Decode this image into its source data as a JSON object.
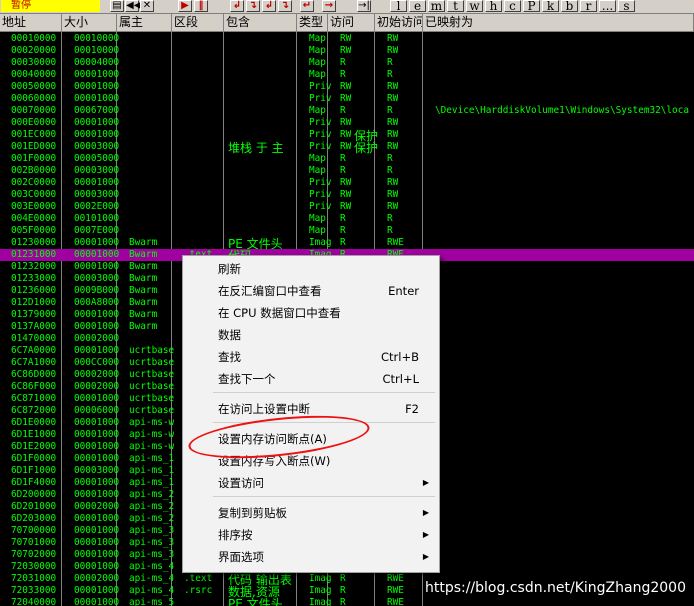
{
  "toolbar": {
    "status": "暂停",
    "icons": [
      "open-icon",
      "rewind-icon",
      "close-icon",
      "run-icon",
      "pause-icon",
      "step-into-icon",
      "step-over-icon",
      "trace-into-icon",
      "trace-over-icon",
      "execute-till-return-icon",
      "goto-icon"
    ],
    "letters": [
      "l",
      "e",
      "m",
      "t",
      "w",
      "h",
      "c",
      "P",
      "k",
      "b",
      "r",
      "...",
      "s"
    ]
  },
  "columns": [
    "地址",
    "大小",
    "属主",
    "区段",
    "包含",
    "类型",
    "访问",
    "初始访问",
    "已映射为"
  ],
  "rows": [
    {
      "addr": "00010000",
      "size": "00010000",
      "owner": "",
      "section": "",
      "contains": "",
      "type": "Map",
      "access": "RW",
      "init": "RW",
      "mapped": ""
    },
    {
      "addr": "00020000",
      "size": "00010000",
      "owner": "",
      "section": "",
      "contains": "",
      "type": "Map",
      "access": "RW",
      "init": "RW",
      "mapped": ""
    },
    {
      "addr": "00030000",
      "size": "00004000",
      "owner": "",
      "section": "",
      "contains": "",
      "type": "Map",
      "access": "R",
      "init": "R",
      "mapped": ""
    },
    {
      "addr": "00040000",
      "size": "00001000",
      "owner": "",
      "section": "",
      "contains": "",
      "type": "Map",
      "access": "R",
      "init": "R",
      "mapped": ""
    },
    {
      "addr": "00050000",
      "size": "00001000",
      "owner": "",
      "section": "",
      "contains": "",
      "type": "Priv",
      "access": "RW",
      "init": "RW",
      "mapped": ""
    },
    {
      "addr": "00060000",
      "size": "00001000",
      "owner": "",
      "section": "",
      "contains": "",
      "type": "Priv",
      "access": "RW",
      "init": "RW",
      "mapped": ""
    },
    {
      "addr": "00070000",
      "size": "00067000",
      "owner": "",
      "section": "",
      "contains": "",
      "type": "Map",
      "access": "R",
      "init": "R",
      "mapped": "\\Device\\HarddiskVolume1\\Windows\\System32\\loca"
    },
    {
      "addr": "000E0000",
      "size": "00001000",
      "owner": "",
      "section": "",
      "contains": "",
      "type": "Priv",
      "access": "RW",
      "init": "RW",
      "mapped": ""
    },
    {
      "addr": "001EC000",
      "size": "00001000",
      "owner": "",
      "section": "",
      "contains": "",
      "type": "Priv",
      "access": "RW",
      "init": "RW",
      "mapped": ""
    },
    {
      "addr": "001ED000",
      "size": "00003000",
      "owner": "",
      "section": "",
      "contains": "",
      "type": "Priv",
      "access": "RW",
      "init": "RW",
      "mapped": ""
    },
    {
      "addr": "001F0000",
      "size": "00005000",
      "owner": "",
      "section": "",
      "contains": "",
      "type": "Map",
      "access": "R",
      "init": "R",
      "mapped": ""
    },
    {
      "addr": "002B0000",
      "size": "00003000",
      "owner": "",
      "section": "",
      "contains": "",
      "type": "Map",
      "access": "R",
      "init": "R",
      "mapped": ""
    },
    {
      "addr": "002C0000",
      "size": "00001000",
      "owner": "",
      "section": "",
      "contains": "",
      "type": "Priv",
      "access": "RW",
      "init": "RW",
      "mapped": ""
    },
    {
      "addr": "003C0000",
      "size": "00003000",
      "owner": "",
      "section": "",
      "contains": "",
      "type": "Priv",
      "access": "RW",
      "init": "RW",
      "mapped": ""
    },
    {
      "addr": "003E0000",
      "size": "0002E000",
      "owner": "",
      "section": "",
      "contains": "",
      "type": "Priv",
      "access": "RW",
      "init": "RW",
      "mapped": ""
    },
    {
      "addr": "004E0000",
      "size": "00101000",
      "owner": "",
      "section": "",
      "contains": "",
      "type": "Map",
      "access": "R",
      "init": "R",
      "mapped": ""
    },
    {
      "addr": "005F0000",
      "size": "0007E000",
      "owner": "",
      "section": "",
      "contains": "",
      "type": "Map",
      "access": "R",
      "init": "R",
      "mapped": ""
    },
    {
      "addr": "01230000",
      "size": "00001000",
      "owner": "Bwarm",
      "section": "",
      "contains": "",
      "type": "Imag",
      "access": "R",
      "init": "RWE",
      "mapped": ""
    },
    {
      "addr": "01231000",
      "size": "00001000",
      "owner": "Bwarm",
      "section": " .text",
      "contains": "",
      "type": "Imag",
      "access": "R",
      "init": "RWE",
      "mapped": ""
    },
    {
      "addr": "01232000",
      "size": "00001000",
      "owner": "Bwarm",
      "section": " .r",
      "contains": "",
      "type": "",
      "access": "",
      "init": "",
      "mapped": ""
    },
    {
      "addr": "01233000",
      "size": "00003000",
      "owner": "Bwarm",
      "section": " .r",
      "contains": "",
      "type": "",
      "access": "",
      "init": "",
      "mapped": ""
    },
    {
      "addr": "01236000",
      "size": "0009B000",
      "owner": "Bwarm",
      "section": " .t",
      "contains": "",
      "type": "",
      "access": "",
      "init": "",
      "mapped": ""
    },
    {
      "addr": "012D1000",
      "size": "000A8000",
      "owner": "Bwarm",
      "section": " .r",
      "contains": "",
      "type": "",
      "access": "",
      "init": "",
      "mapped": ""
    },
    {
      "addr": "01379000",
      "size": "00001000",
      "owner": "Bwarm",
      "section": " .r",
      "contains": "",
      "type": "",
      "access": "",
      "init": "",
      "mapped": ""
    },
    {
      "addr": "0137A000",
      "size": "00001000",
      "owner": "Bwarm",
      "section": " .r",
      "contains": "",
      "type": "",
      "access": "",
      "init": "",
      "mapped": ""
    },
    {
      "addr": "01470000",
      "size": "00002000",
      "owner": "",
      "section": "",
      "contains": "",
      "type": "",
      "access": "",
      "init": "",
      "mapped": ""
    },
    {
      "addr": "6C7A0000",
      "size": "00001000",
      "owner": "ucrtbase",
      "section": "",
      "contains": "",
      "type": "",
      "access": "",
      "init": "",
      "mapped": ""
    },
    {
      "addr": "6C7A1000",
      "size": "000CC000",
      "owner": "ucrtbase",
      "section": " .t",
      "contains": "",
      "type": "",
      "access": "",
      "init": "",
      "mapped": ""
    },
    {
      "addr": "6C86D000",
      "size": "00002000",
      "owner": "ucrtbase",
      "section": " .d",
      "contains": "",
      "type": "",
      "access": "",
      "init": "",
      "mapped": ""
    },
    {
      "addr": "6C86F000",
      "size": "00002000",
      "owner": "ucrtbase",
      "section": " .i",
      "contains": "",
      "type": "",
      "access": "",
      "init": "",
      "mapped": ""
    },
    {
      "addr": "6C871000",
      "size": "00001000",
      "owner": "ucrtbase",
      "section": " .r",
      "contains": "",
      "type": "",
      "access": "",
      "init": "",
      "mapped": ""
    },
    {
      "addr": "6C872000",
      "size": "00006000",
      "owner": "ucrtbase",
      "section": " .r",
      "contains": "",
      "type": "",
      "access": "",
      "init": "",
      "mapped": ""
    },
    {
      "addr": "6D1E0000",
      "size": "00001000",
      "owner": "api-ms-w",
      "section": "",
      "contains": "",
      "type": "",
      "access": "",
      "init": "",
      "mapped": ""
    },
    {
      "addr": "6D1E1000",
      "size": "00001000",
      "owner": "api-ms-w",
      "section": " .r",
      "contains": "",
      "type": "",
      "access": "",
      "init": "",
      "mapped": ""
    },
    {
      "addr": "6D1E2000",
      "size": "00001000",
      "owner": "api-ms-w",
      "section": " .r",
      "contains": "",
      "type": "",
      "access": "",
      "init": "",
      "mapped": ""
    },
    {
      "addr": "6D1F0000",
      "size": "00001000",
      "owner": "api-ms_1",
      "section": "",
      "contains": "",
      "type": "",
      "access": "",
      "init": "",
      "mapped": ""
    },
    {
      "addr": "6D1F1000",
      "size": "00003000",
      "owner": "api-ms_1",
      "section": " .t",
      "contains": "",
      "type": "",
      "access": "",
      "init": "",
      "mapped": ""
    },
    {
      "addr": "6D1F4000",
      "size": "00001000",
      "owner": "api-ms_1",
      "section": " .r",
      "contains": "",
      "type": "",
      "access": "",
      "init": "",
      "mapped": ""
    },
    {
      "addr": "6D200000",
      "size": "00001000",
      "owner": "api-ms_2",
      "section": "",
      "contains": "",
      "type": "",
      "access": "",
      "init": "",
      "mapped": ""
    },
    {
      "addr": "6D201000",
      "size": "00002000",
      "owner": "api-ms_2",
      "section": " .t",
      "contains": "",
      "type": "",
      "access": "",
      "init": "",
      "mapped": ""
    },
    {
      "addr": "6D203000",
      "size": "00001000",
      "owner": "api-ms_2",
      "section": " .r",
      "contains": "",
      "type": "",
      "access": "",
      "init": "",
      "mapped": ""
    },
    {
      "addr": "70700000",
      "size": "00001000",
      "owner": "api-ms_3",
      "section": "",
      "contains": "",
      "type": "",
      "access": "",
      "init": "",
      "mapped": ""
    },
    {
      "addr": "70701000",
      "size": "00001000",
      "owner": "api-ms_3",
      "section": " .t",
      "contains": "",
      "type": "",
      "access": "",
      "init": "",
      "mapped": ""
    },
    {
      "addr": "70702000",
      "size": "00001000",
      "owner": "api-ms_3",
      "section": " .r",
      "contains": "",
      "type": "",
      "access": "",
      "init": "",
      "mapped": ""
    },
    {
      "addr": "72030000",
      "size": "00001000",
      "owner": "api-ms_4",
      "section": "",
      "contains": "",
      "type": "",
      "access": "",
      "init": "",
      "mapped": ""
    },
    {
      "addr": "72031000",
      "size": "00002000",
      "owner": "api-ms_4",
      "section": " .text",
      "contains": "",
      "type": "Imag",
      "access": "R",
      "init": "RWE",
      "mapped": ""
    },
    {
      "addr": "72033000",
      "size": "00001000",
      "owner": "api-ms_4",
      "section": " .rsrc",
      "contains": "",
      "type": "Imag",
      "access": "R",
      "init": "RWE",
      "mapped": ""
    },
    {
      "addr": "72040000",
      "size": "00001000",
      "owner": "api-ms_5",
      "section": "",
      "contains": "",
      "type": "Imag",
      "access": "R",
      "init": "RWE",
      "mapped": ""
    }
  ],
  "contains_text": {
    "row9": "堆栈 于  主",
    "row8_init": "保护",
    "row9_init": "保护",
    "row17": "PE 文件头",
    "row18": "代码",
    "row45": "代码 输出表",
    "row46": "数据,资源",
    "row47": "PE 文件头"
  },
  "context_menu": {
    "items": [
      {
        "label": "刷新",
        "shortcut": "",
        "submenu": false
      },
      {
        "label": "在反汇编窗口中查看",
        "shortcut": "Enter",
        "submenu": false
      },
      {
        "label": "在 CPU 数据窗口中查看",
        "shortcut": "",
        "submenu": false
      },
      {
        "label": "数据",
        "shortcut": "",
        "submenu": false
      },
      {
        "label": "查找",
        "shortcut": "Ctrl+B",
        "submenu": false
      },
      {
        "label": "查找下一个",
        "shortcut": "Ctrl+L",
        "submenu": false
      },
      {
        "label": "在访问上设置中断",
        "shortcut": "F2",
        "submenu": false
      },
      {
        "label": "设置内存访问断点(A)",
        "shortcut": "",
        "submenu": false
      },
      {
        "label": "设置内存写入断点(W)",
        "shortcut": "",
        "submenu": false
      },
      {
        "label": "设置访问",
        "shortcut": "",
        "submenu": true
      },
      {
        "label": "复制到剪贴板",
        "shortcut": "",
        "submenu": true
      },
      {
        "label": "排序按",
        "shortcut": "",
        "submenu": true
      },
      {
        "label": "界面选项",
        "shortcut": "",
        "submenu": true
      }
    ]
  },
  "watermark": "https://blog.csdn.net/KingZhang2000",
  "colors": {
    "background": "#000000",
    "text": "#00ff00",
    "selected_row": "#a000a0",
    "highlight_circle": "#e11111"
  }
}
